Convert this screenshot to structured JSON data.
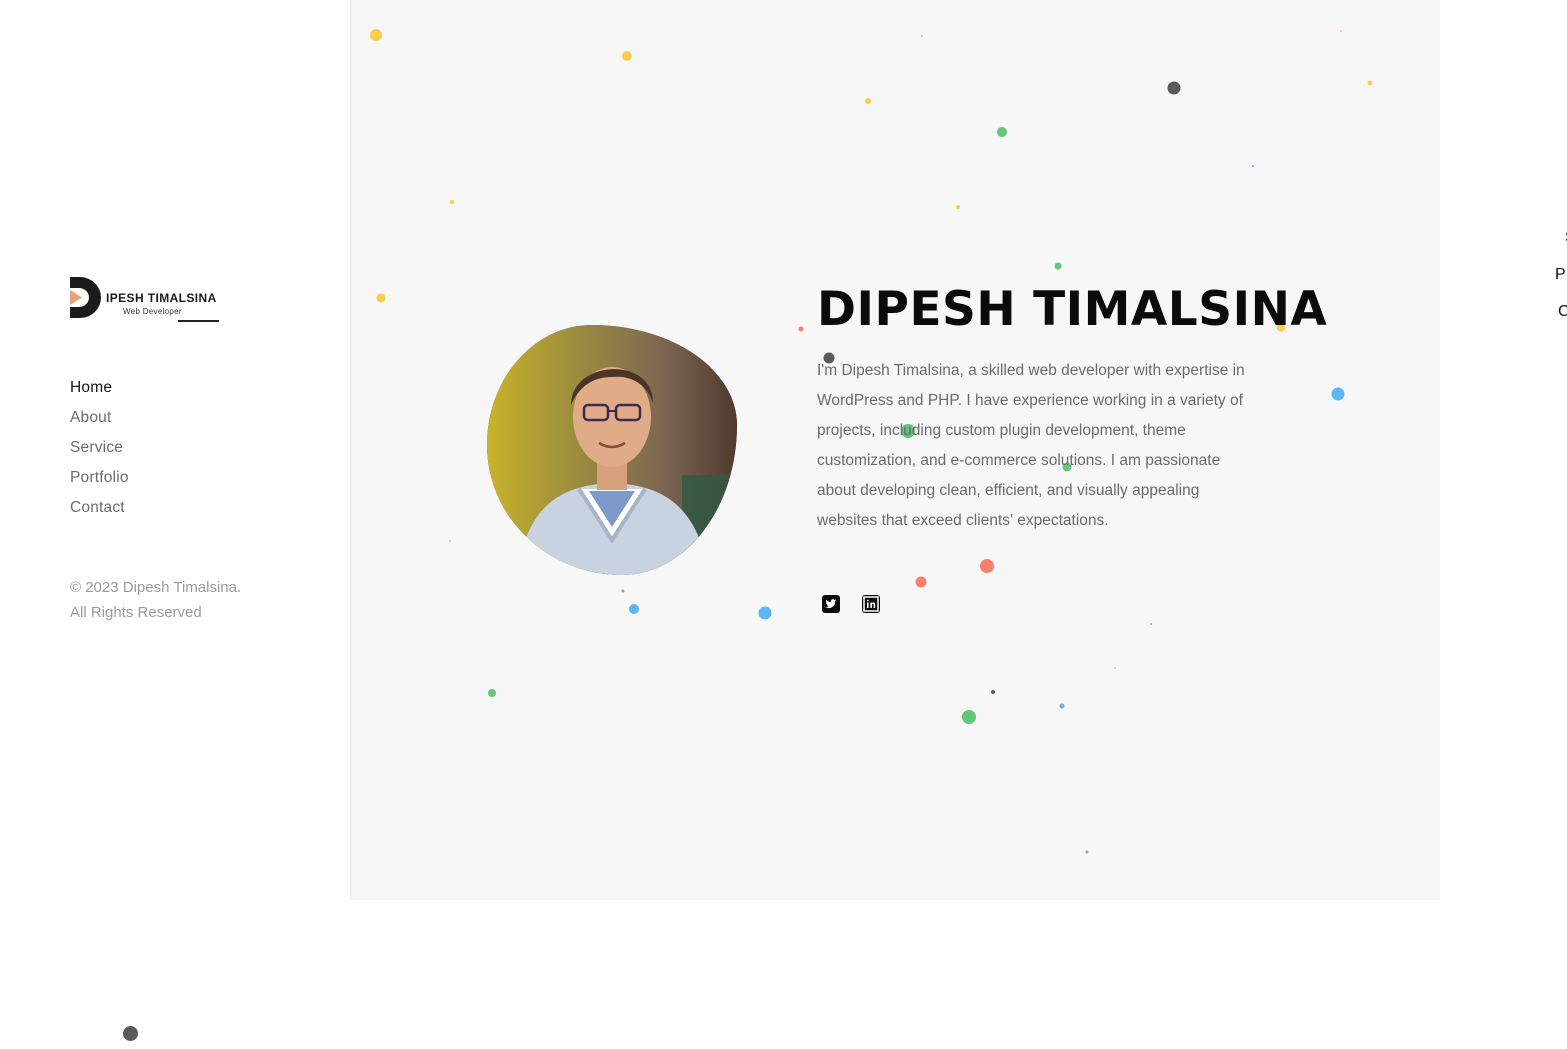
{
  "brand": {
    "name": "IPESH TIMALSINA",
    "tagline": "Web Developer",
    "mark_color": "#1b1b1b",
    "accent_color": "#e8a27a"
  },
  "sidebar": {
    "nav": [
      {
        "label": "Home",
        "active": true
      },
      {
        "label": "About",
        "active": false
      },
      {
        "label": "Service",
        "active": false
      },
      {
        "label": "Portfolio",
        "active": false
      },
      {
        "label": "Contact",
        "active": false
      }
    ],
    "copyright_line1": "© 2023 Dipesh Timalsina.",
    "copyright_line2": "All Rights Reserved"
  },
  "hero": {
    "title": "DIPESH TIMALSINA",
    "bio": "I'm Dipesh Timalsina, a skilled web developer with expertise in WordPress and PHP. I have experience working in a variety of projects, including custom plugin development, theme customization, and e-commerce solutions. I am passionate about developing clean, efficient, and visually appealing websites that exceed clients' expectations.",
    "socials": [
      {
        "name": "twitter-icon"
      },
      {
        "name": "linkedin-icon"
      }
    ],
    "background_color": "#f7f7f7",
    "particle_colors": [
      "#fbcd4a",
      "#62c77a",
      "#5eb6f2",
      "#f4826a",
      "#5a5a5a"
    ]
  },
  "right_menu": {
    "items": [
      "S",
      "P",
      "C"
    ]
  }
}
